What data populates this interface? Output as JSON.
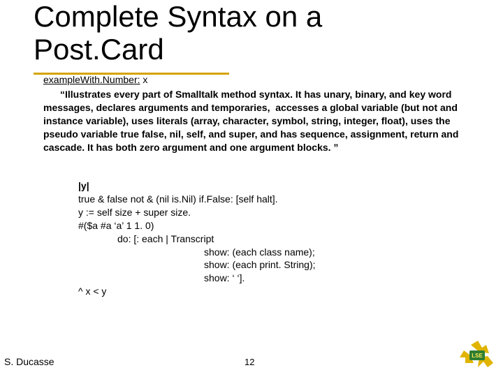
{
  "title_line1": "Complete Syntax on a",
  "title_line2": "Post.Card",
  "method_signature": "example​With.Number:",
  "method_arg": " x",
  "description": "“Illustrates every part of Smalltalk method syntax. It has unary, binary, and key word messages, declares arguments and temporaries,  accesses a global variable (but not and instance variable), uses literals (array, character, symbol, string, integer, float), uses the pseudo variable true false, nil, self, and super, and has sequence, assignment, return and cascade. It has both zero argument and one argument blocks. ”",
  "code": {
    "y_decl": "|y|",
    "line1": "true & false not & (nil is.Nil) if.False: [self halt].",
    "line2": "y := self size + super size.",
    "line3": "#($a #a ‘a’ 1 1. 0)",
    "line4": "do: [: each | Transcript",
    "line5": "show: (each class name);",
    "line6": "show: (each print. String);",
    "line7": "show: ‘ ‘].",
    "line8": "^ x < y"
  },
  "author": "S. Ducasse",
  "page_number": "12",
  "logo_text": "LSE"
}
